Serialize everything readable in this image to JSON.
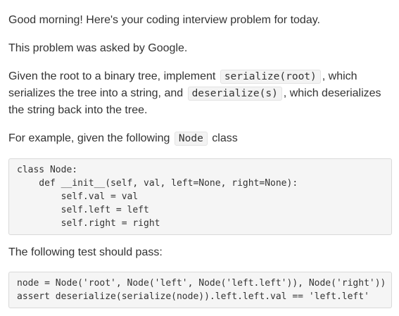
{
  "intro": {
    "greeting": "Good morning! Here's your coding interview problem for today.",
    "source": "This problem was asked by Google."
  },
  "problem": {
    "text_a": "Given the root to a binary tree, implement ",
    "code_a": "serialize(root)",
    "text_b": ", which serializes the tree into a string, and ",
    "code_b": "deserialize(s)",
    "text_c": ", which deserializes the string back into the tree."
  },
  "example": {
    "text_a": "For example, given the following ",
    "code": "Node",
    "text_b": " class"
  },
  "class_code": {
    "lines": [
      "class Node:",
      "    def __init__(self, val, left=None, right=None):",
      "        self.val = val",
      "        self.left = left",
      "        self.right = right"
    ]
  },
  "test_intro": "The following test should pass:",
  "test_code": {
    "lines": [
      "node = Node('root', Node('left', Node('left.left')), Node('right'))",
      "assert deserialize(serialize(node)).left.left.val == 'left.left'"
    ]
  }
}
